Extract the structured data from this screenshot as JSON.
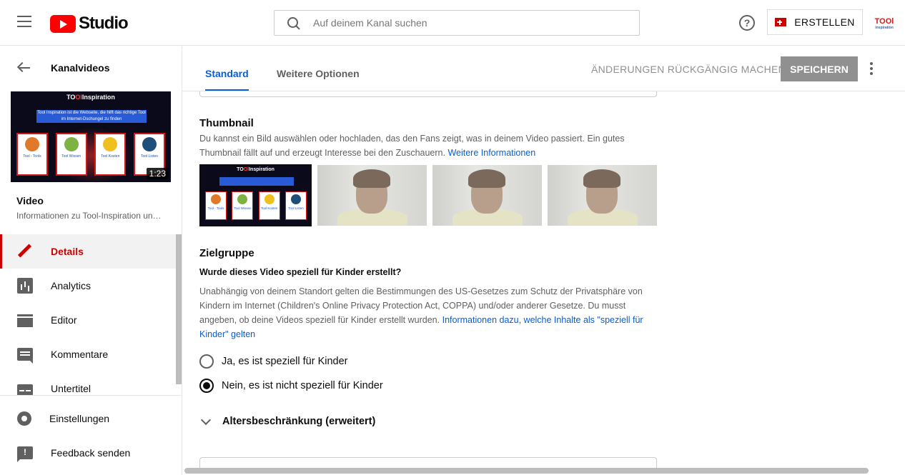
{
  "header": {
    "logo_text": "Studio",
    "search_placeholder": "Auf deinem Kanal suchen",
    "help_label": "?",
    "create_label": "ERSTELLEN",
    "avatar_text": "TOOl",
    "avatar_sub": "inspiration"
  },
  "sidebar": {
    "back_label": "Kanalvideos",
    "video": {
      "thumb_title_a": "TO",
      "thumb_title_b": "Ol",
      "thumb_title_c": "Inspiration",
      "banner_text": "Tool Inspiration ist die Webseite, die hilft das richtige Tool im Internet-Dschungel zu finden",
      "cards": [
        {
          "label": "Tool - Tools",
          "color": "#e07a2a"
        },
        {
          "label": "Tool Wissen",
          "color": "#7cb342"
        },
        {
          "label": "Tool Kosten",
          "color": "#f0c020"
        },
        {
          "label": "Tool Listen",
          "color": "#1e4f7a"
        }
      ],
      "duration": "1:23",
      "label": "Video",
      "subtitle": "Informationen zu Tool-Inspiration un…"
    },
    "nav": [
      {
        "label": "Details",
        "active": true
      },
      {
        "label": "Analytics"
      },
      {
        "label": "Editor"
      },
      {
        "label": "Kommentare"
      },
      {
        "label": "Untertitel"
      }
    ],
    "bottom": [
      {
        "label": "Einstellungen"
      },
      {
        "label": "Feedback senden"
      }
    ]
  },
  "main": {
    "tabs": [
      {
        "label": "Standard",
        "active": true
      },
      {
        "label": "Weitere Optionen"
      }
    ],
    "undo_label": "ÄNDERUNGEN RÜCKGÄNGIG MACHEN",
    "save_label": "SPEICHERN",
    "thumbnail": {
      "title": "Thumbnail",
      "text": "Du kannst ein Bild auswählen oder hochladen, das den Fans zeigt, was in deinem Video passiert. Ein gutes Thumbnail fällt auf und erzeugt Interesse bei den Zuschauern.",
      "link": "Weitere Informationen"
    },
    "audience": {
      "title": "Zielgruppe",
      "question": "Wurde dieses Video speziell für Kinder erstellt?",
      "text": "Unabhängig von deinem Standort gelten die Bestimmungen des US-Gesetzes zum Schutz der Privatsphäre von Kindern im Internet (Children's Online Privacy Protection Act, COPPA) und/oder anderer Gesetze. Du musst angeben, ob deine Videos speziell für Kinder erstellt wurden.",
      "link": "Informationen dazu, welche Inhalte als \"speziell für Kinder\" gelten",
      "option_yes": "Ja, es ist speziell für Kinder",
      "option_no": "Nein, es ist nicht speziell für Kinder",
      "selected": "no"
    },
    "age_restriction_label": "Altersbeschränkung (erweitert)"
  },
  "colors": {
    "accent_red": "#cc0000",
    "link_blue": "#065fd4",
    "save_disabled": "#909090"
  }
}
